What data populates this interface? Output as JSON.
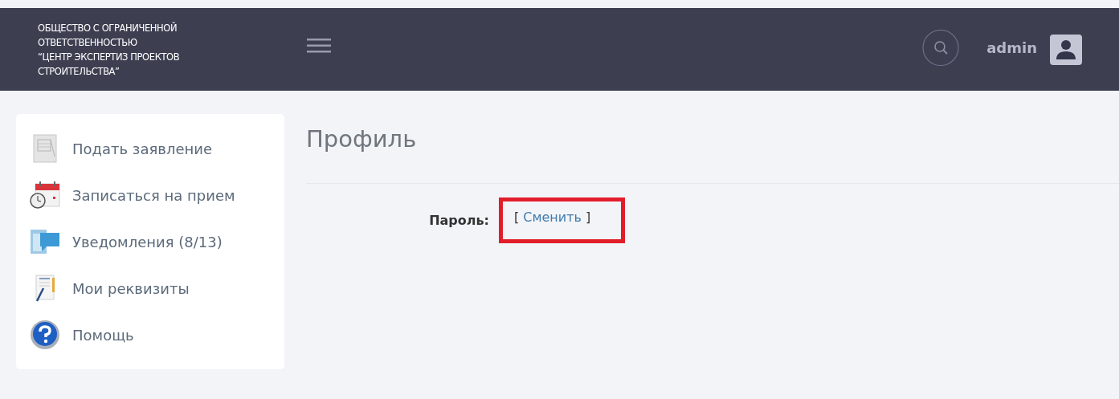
{
  "header": {
    "org_name": [
      "ОБЩЕСТВО С ОГРАНИЧЕННОЙ",
      "ОТВЕТСТВЕННОСТЬЮ",
      "“ЦЕНТР ЭКСПЕРТИЗ ПРОЕКТОВ",
      "СТРОИТЕЛЬСТВА”"
    ],
    "user": "admin"
  },
  "sidebar": {
    "items": [
      {
        "kind": "form",
        "label": "Подать заявление"
      },
      {
        "kind": "calendar",
        "label": "Записаться на прием"
      },
      {
        "kind": "messages",
        "label": "Уведомления (8/13)"
      },
      {
        "kind": "document",
        "label": "Мои реквизиты"
      },
      {
        "kind": "help",
        "label": "Помощь"
      }
    ]
  },
  "page": {
    "title": "Профиль",
    "fields": [
      {
        "label": "Пароль:",
        "bracket_open": "[",
        "link": "Сменить",
        "bracket_close": "]",
        "highlighted": true
      }
    ]
  }
}
